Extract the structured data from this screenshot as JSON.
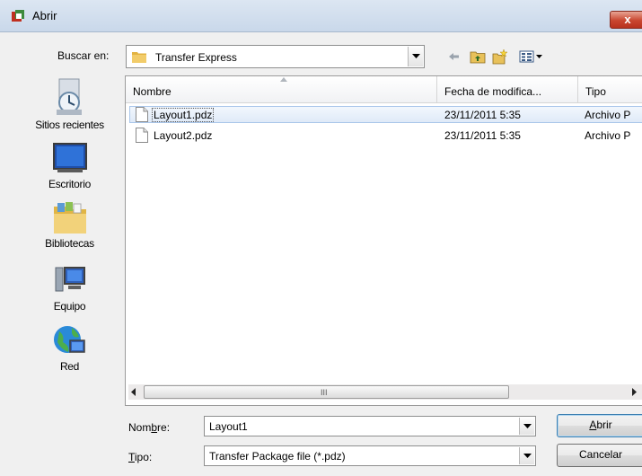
{
  "window": {
    "title": "Abrir",
    "close_label": "x"
  },
  "lookin": {
    "label": "Buscar en:",
    "value": "Transfer Express"
  },
  "toolbar": {
    "icons": [
      "back-arrow-icon",
      "up-folder-icon",
      "new-folder-icon",
      "view-menu-icon"
    ]
  },
  "places": [
    {
      "label": "Sitios recientes",
      "icon": "recent-places-icon"
    },
    {
      "label": "Escritorio",
      "icon": "desktop-icon"
    },
    {
      "label": "Bibliotecas",
      "icon": "libraries-icon"
    },
    {
      "label": "Equipo",
      "icon": "computer-icon"
    },
    {
      "label": "Red",
      "icon": "network-icon"
    }
  ],
  "columns": [
    "Nombre",
    "Fecha de modifica...",
    "Tipo"
  ],
  "files": [
    {
      "name": "Layout1.pdz",
      "date": "23/11/2011 5:35",
      "type": "Archivo P",
      "selected": true
    },
    {
      "name": "Layout2.pdz",
      "date": "23/11/2011 5:35",
      "type": "Archivo P",
      "selected": false
    }
  ],
  "scrollbar": {
    "grip": "III"
  },
  "filename": {
    "label_pre": "Nom",
    "label_accel": "b",
    "label_post": "re:",
    "value": "Layout1"
  },
  "filetype": {
    "label_pre": "",
    "label_accel": "T",
    "label_post": "ipo:",
    "value": "Transfer Package file (*.pdz)"
  },
  "buttons": {
    "open_accel": "A",
    "open_rest": "brir",
    "cancel": "Cancelar"
  }
}
